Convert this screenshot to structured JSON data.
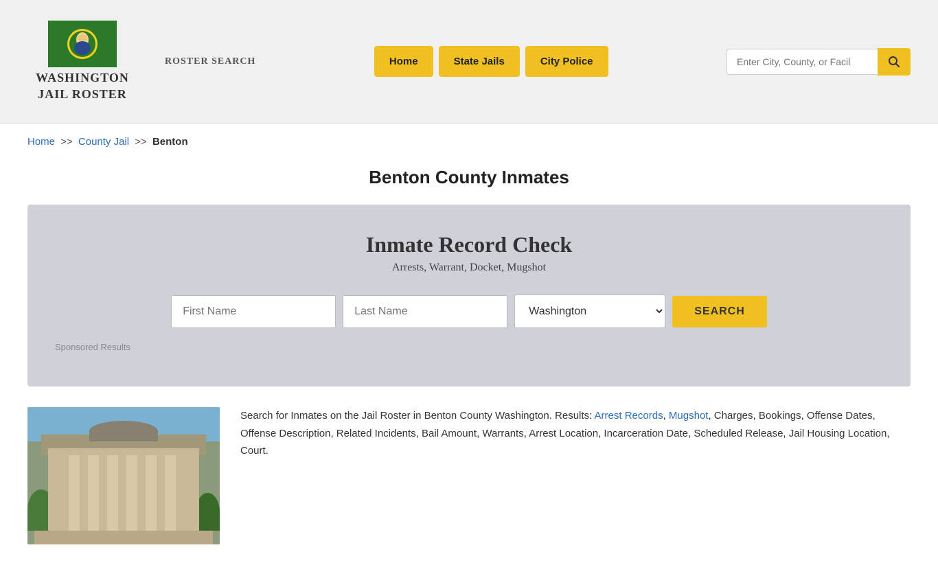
{
  "header": {
    "site_title_line1": "WASHINGTON",
    "site_title_line2": "JAIL ROSTER",
    "roster_search_label": "ROSTER SEARCH",
    "nav": {
      "home_label": "Home",
      "state_jails_label": "State Jails",
      "city_police_label": "City Police"
    },
    "search_placeholder": "Enter City, County, or Facil"
  },
  "breadcrumb": {
    "home": "Home",
    "sep1": ">>",
    "county_jail": "County Jail",
    "sep2": ">>",
    "current": "Benton"
  },
  "page_title": "Benton County Inmates",
  "record_check": {
    "title": "Inmate Record Check",
    "subtitle": "Arrests, Warrant, Docket, Mugshot",
    "first_name_placeholder": "First Name",
    "last_name_placeholder": "Last Name",
    "state_value": "Washington",
    "search_button": "SEARCH",
    "sponsored_label": "Sponsored Results"
  },
  "description": {
    "text": "Search for Inmates on the Jail Roster in Benton County Washington. Results: Arrest Records, Mugshot, Charges, Bookings, Offense Dates, Offense Description, Related Incidents, Bail Amount, Warrants, Arrest Location, Incarceration Date, Scheduled Release, Jail Housing Location, Court.",
    "links": [
      "Arrest Records",
      "Mugshot"
    ]
  },
  "colors": {
    "nav_button_bg": "#f0c020",
    "link_blue": "#2a6ebb"
  }
}
